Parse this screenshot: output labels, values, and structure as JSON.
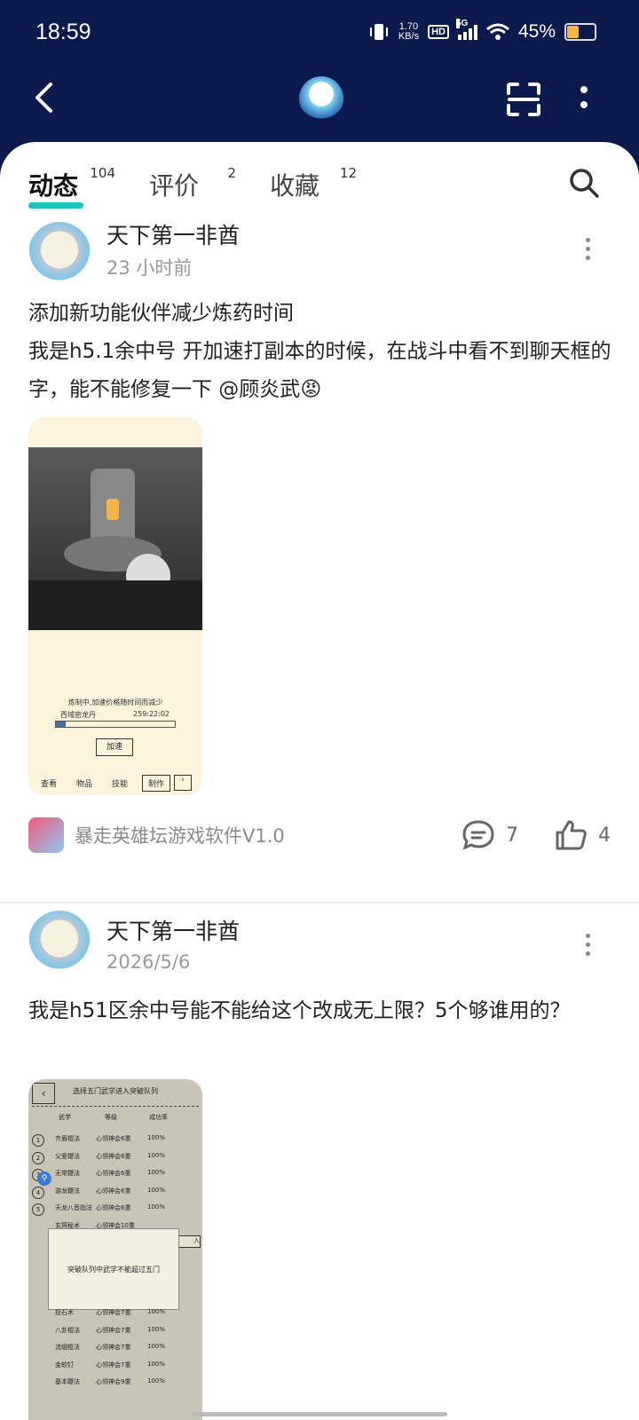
{
  "status": {
    "time": "18:59",
    "speed_top": "1.70",
    "speed_bottom": "KB/s",
    "hd": "HD",
    "network": "5G",
    "battery_text": "45%",
    "battery_level": 0.45
  },
  "header": {
    "back_icon": "back-arrow-icon",
    "scan_icon": "scan-icon",
    "more_icon": "more-vertical-icon",
    "logo": "game-logo"
  },
  "tabs": [
    {
      "label": "动态",
      "count": "104"
    },
    {
      "label": "评价",
      "count": "2"
    },
    {
      "label": "收藏",
      "count": "12"
    }
  ],
  "posts": [
    {
      "author": "天下第一非酋",
      "time": "23 小时前",
      "line1": "添加新功能伙伴减少炼药时间",
      "line2": "我是h5.1余中号 开加速打副本的时候，在战斗中看不到聊天框的字，能不能修复一下 @顾炎武",
      "emoji": "😡",
      "image": {
        "caption": "炼制中,加速价格随时间而减少",
        "item": "西域密龙丹",
        "countdown": "259:22:02",
        "progress": 0.08,
        "button": "加速",
        "nav": [
          "查看",
          "物品",
          "技能",
          "制作"
        ]
      },
      "game_name": "暴走英雄坛游戏软件V1.0",
      "comments": "7",
      "likes": "4"
    },
    {
      "author": "天下第一非酋",
      "time": "2026/5/6",
      "text": "我是h51区余中号能不能给这个改成无上限？5个够谁用的？",
      "image": {
        "title": "选择五门武学进入突破队列",
        "headers": [
          "武学",
          "等级",
          "成功率"
        ],
        "rows": [
          {
            "num": "1",
            "name": "齐眉棍法",
            "level": "心领神会6重",
            "rate": "100%"
          },
          {
            "num": "2",
            "name": "父爱鞭法",
            "level": "心领神会6重",
            "rate": "100%"
          },
          {
            "num": "3",
            "name": "无常鞭法",
            "level": "心领神会6重",
            "rate": "100%"
          },
          {
            "num": "4",
            "name": "游龙鞭法",
            "level": "心领神会6重",
            "rate": "100%"
          },
          {
            "num": "5",
            "name": "天龙八音指法",
            "level": "心领神会6重",
            "rate": "100%"
          },
          {
            "num": "",
            "name": "玄冥秘术",
            "level": "心领神会10重",
            "rate": ""
          }
        ],
        "dialog": "突破队列中武学不能超过五门",
        "rows_below": [
          {
            "name": "投石术",
            "level": "心领神会7重",
            "rate": "100%"
          },
          {
            "name": "八卦棍法",
            "level": "心领神会7重",
            "rate": "100%"
          },
          {
            "name": "流烟棍法",
            "level": "心领神会7重",
            "rate": "100%"
          },
          {
            "name": "金蛟钉",
            "level": "心领神会7重",
            "rate": "100%"
          },
          {
            "name": "基本鞭法",
            "level": "心领神会9重",
            "rate": "100%"
          }
        ],
        "side_btn": "入"
      }
    }
  ]
}
